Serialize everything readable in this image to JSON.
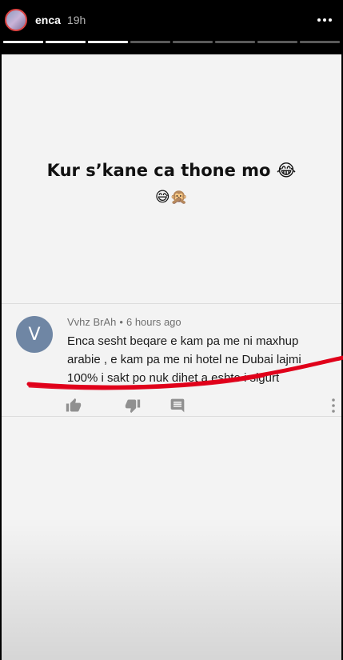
{
  "story": {
    "username": "enca",
    "time": "19h",
    "segments_total": 8,
    "segments_done": 3
  },
  "caption": {
    "line1": "Kur s’kane ca thone mo 😂",
    "line2": "😅🙊"
  },
  "comment": {
    "avatar_letter": "V",
    "author": "Vvhz BrAh",
    "separator": "•",
    "timestamp": "6 hours ago",
    "text": "Enca sesht beqare e kam pa me ni maxhup arabie , e kam pa me ni hotel ne Dubai lajmi 100% i sakt po nuk dihet a eshte i sigurt"
  },
  "icons": {
    "more": "more-horizontal-icon",
    "like": "thumbs-up-icon",
    "dislike": "thumbs-down-icon",
    "reply": "comment-icon",
    "comment_menu": "more-vertical-icon"
  },
  "colors": {
    "card_bg": "#f3f3f3",
    "comment_avatar": "#6f86a4",
    "scribble": "#e0001a",
    "icon_gray": "#909090"
  }
}
